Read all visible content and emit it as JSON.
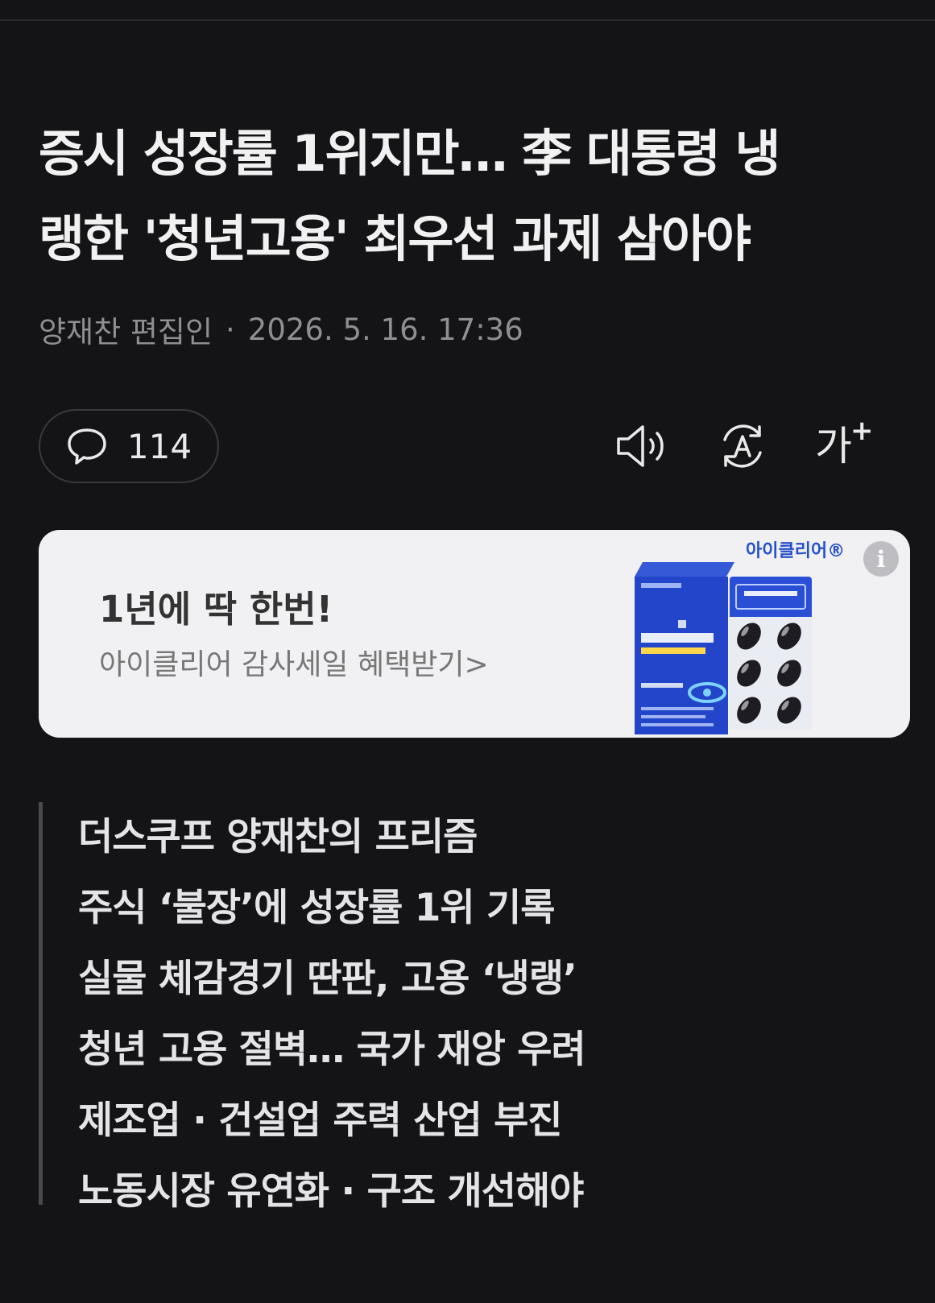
{
  "article": {
    "title_line1": "증시 성장률 1위지만… 李 대통령 냉",
    "title_line2": "랭한 '청년고용' 최우선 과제 삼아야",
    "author": "양재찬 편집인",
    "date": "2026. 5. 16. 17:36"
  },
  "toolbar": {
    "comment_count": "114",
    "font_size_label": "가"
  },
  "ad": {
    "headline": "1년에 딱 한번!",
    "subtext": "아이클리어 감사세일 혜택받기>",
    "brand": "아이클리어®"
  },
  "summary": {
    "lines": [
      "더스쿠프 양재찬의 프리즘",
      "주식 ‘불장’에 성장률 1위 기록",
      "실물 체감경기 딴판, 고용 ‘냉랭’",
      "청년 고용 절벽… 국가 재앙 우려",
      "제조업 · 건설업 주력 산업 부진",
      "노동시장 유연화 · 구조 개선해야"
    ]
  },
  "icons": {
    "comment": "speech-bubble-icon",
    "audio": "speaker-icon",
    "translate": "translate-icon",
    "font_size": "font-size-icon",
    "info": "info-icon"
  }
}
